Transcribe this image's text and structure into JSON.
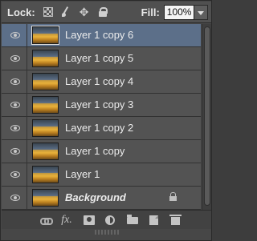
{
  "lockbar": {
    "lock_label": "Lock:",
    "lock_icons": [
      "transparency-lock-icon",
      "paint-lock-icon",
      "move-lock-icon",
      "full-lock-icon"
    ],
    "fill_label": "Fill:",
    "fill_value": "100%"
  },
  "layers": [
    {
      "name": "Layer 1 copy 6",
      "selected": true,
      "visible": true,
      "locked": false
    },
    {
      "name": "Layer 1 copy 5",
      "selected": false,
      "visible": true,
      "locked": false
    },
    {
      "name": "Layer 1 copy 4",
      "selected": false,
      "visible": true,
      "locked": false
    },
    {
      "name": "Layer 1 copy 3",
      "selected": false,
      "visible": true,
      "locked": false
    },
    {
      "name": "Layer 1 copy 2",
      "selected": false,
      "visible": true,
      "locked": false
    },
    {
      "name": "Layer 1 copy",
      "selected": false,
      "visible": true,
      "locked": false
    },
    {
      "name": "Layer 1",
      "selected": false,
      "visible": true,
      "locked": false
    },
    {
      "name": "Background",
      "selected": false,
      "visible": true,
      "locked": true
    }
  ],
  "bottombar": {
    "icons": [
      "link-layers-icon",
      "fx-icon",
      "layer-mask-icon",
      "adjustment-layer-icon",
      "group-folder-icon",
      "new-layer-icon",
      "delete-layer-icon"
    ]
  },
  "colors": {
    "selection": "#5c6f89",
    "panel_bg": "#474747",
    "row_bg": "#535353"
  }
}
